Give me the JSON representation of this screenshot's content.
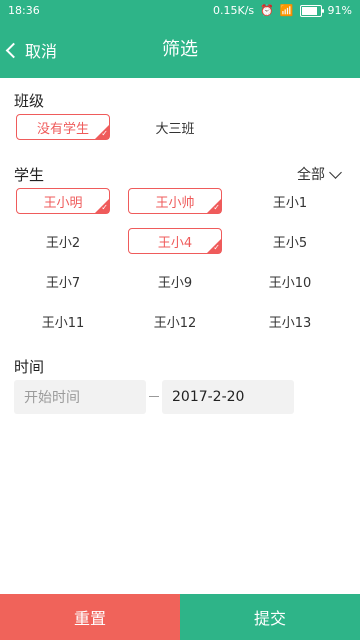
{
  "status": {
    "time": "18:36",
    "speed": "0.15K/s",
    "battery": "91%",
    "battery_level": 0.91
  },
  "appbar": {
    "back_label": "取消",
    "title": "筛选"
  },
  "class_section": {
    "label": "班级",
    "items": [
      {
        "label": "没有学生",
        "selected": true
      },
      {
        "label": "大三班",
        "selected": false
      }
    ]
  },
  "student_section": {
    "label": "学生",
    "toggle_label": "全部",
    "items": [
      {
        "label": "王小明",
        "selected": true
      },
      {
        "label": "王小帅",
        "selected": true
      },
      {
        "label": "王小1",
        "selected": false
      },
      {
        "label": "王小2",
        "selected": false
      },
      {
        "label": "王小4",
        "selected": true
      },
      {
        "label": "王小5",
        "selected": false
      },
      {
        "label": "王小7",
        "selected": false
      },
      {
        "label": "王小9",
        "selected": false
      },
      {
        "label": "王小10",
        "selected": false
      },
      {
        "label": "王小11",
        "selected": false
      },
      {
        "label": "王小12",
        "selected": false
      },
      {
        "label": "王小13",
        "selected": false
      }
    ]
  },
  "time_section": {
    "label": "时间",
    "start_placeholder": "开始时间",
    "end_value": "2017-2-20"
  },
  "footer": {
    "reset_label": "重置",
    "submit_label": "提交"
  },
  "colors": {
    "accent": "#2eb488",
    "selected": "#ef5b5b",
    "reset": "#f0635a"
  }
}
